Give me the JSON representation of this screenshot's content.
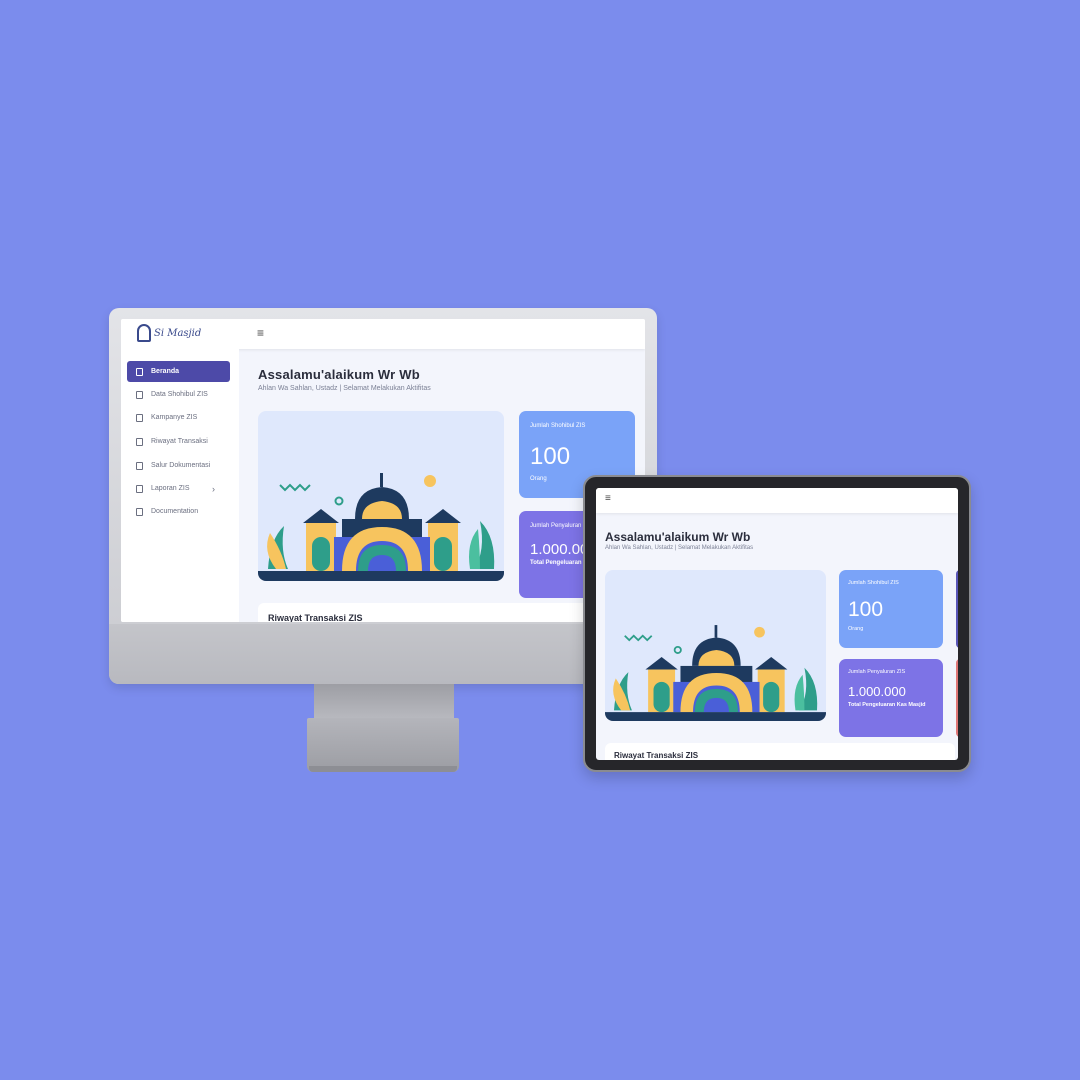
{
  "app": {
    "logo_text": "Si Masjid"
  },
  "sidebar": {
    "items": [
      {
        "label": "Beranda",
        "icon": "grid-icon",
        "active": true
      },
      {
        "label": "Data Shohibul ZIS",
        "icon": "document-icon"
      },
      {
        "label": "Kampanye ZIS",
        "icon": "document-icon"
      },
      {
        "label": "Riwayat Transaksi",
        "icon": "document-icon"
      },
      {
        "label": "Salur Dokumentasi",
        "icon": "mail-icon"
      },
      {
        "label": "Laporan ZIS",
        "icon": "document-icon",
        "has_submenu": true
      },
      {
        "label": "Documentation",
        "icon": "document-icon"
      }
    ]
  },
  "main": {
    "greeting": "Assalamu'alaikum Wr Wb",
    "subtitle": "Ahlan Wa Sahlan, Ustadz | Selamat Melakukan Aktifitas",
    "cards": [
      {
        "label": "Jumlah Shohibul ZIS",
        "value": "100",
        "caption": "Orang",
        "color": "#7aa3f8"
      },
      {
        "label": "Jumlah Penyaluran ZIS",
        "value": "1.000.000",
        "caption": "Total Pengeluaran Kas Masjid",
        "color": "#7d73e6"
      }
    ],
    "table_title": "Riwayat Transaksi ZIS"
  },
  "colors": {
    "background": "#7b8ced",
    "sidebar_active": "#4d4aa8",
    "card_extra_1": "#5a56b8",
    "card_extra_2": "#e07777"
  },
  "icons": {
    "menu": "hamburger-icon",
    "chevron": "chevron-right-icon"
  }
}
